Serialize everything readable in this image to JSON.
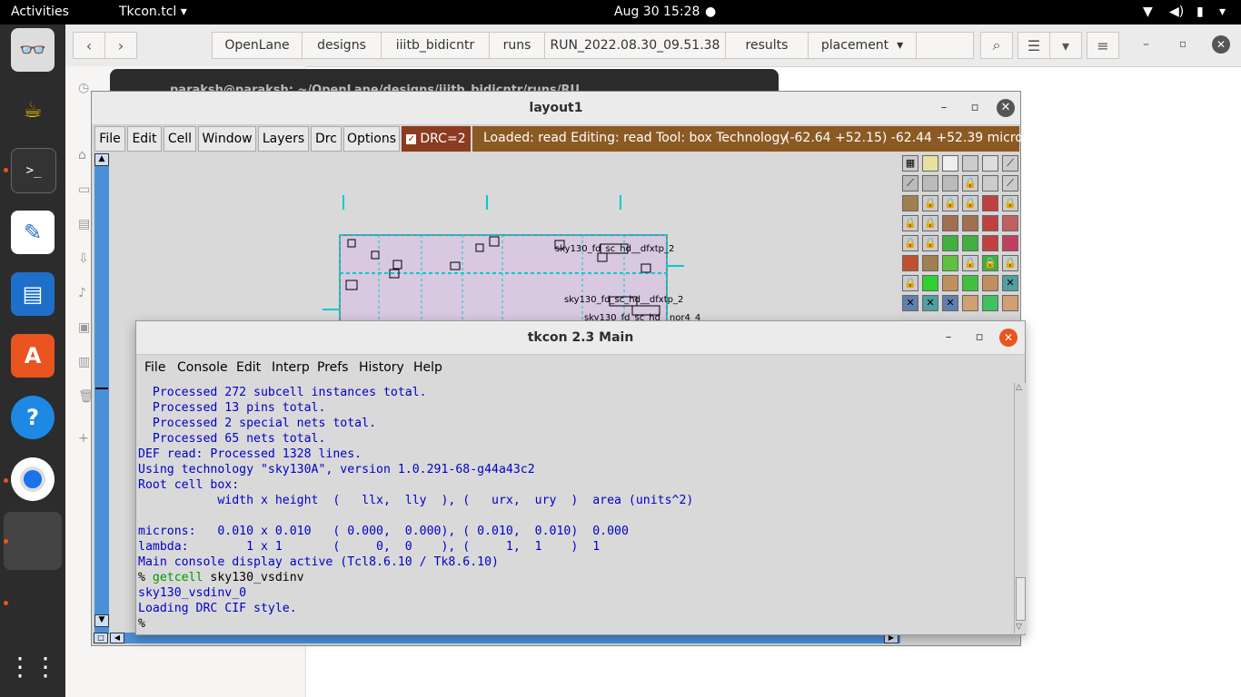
{
  "topbar": {
    "activities": "Activities",
    "app_name": "Tkcon.tcl",
    "datetime": "Aug 30  15:28"
  },
  "nautilus": {
    "path": [
      "OpenLane",
      "designs",
      "iiitb_bidicntr",
      "runs",
      "RUN_2022.08.30_09.51.38",
      "results",
      "placement"
    ]
  },
  "bg_terminal": {
    "title": "paraksh@paraksh: ~/OpenLane/designs/iiitb_bidicntr/runs/RU..."
  },
  "layout1": {
    "title": "layout1",
    "menu": [
      "File",
      "Edit",
      "Cell",
      "Window",
      "Layers",
      "Drc",
      "Options"
    ],
    "drc_label": "DRC=2",
    "status_text": "Loaded: read Editing: read Tool: box  Technology",
    "coords": "(-62.64 +52.15) -62.44 +52.39 microns",
    "cell_labels": [
      "sky130_fd_sc_hd__dfxtp_2",
      "sky130_fd_sc_hd__dfxtp_2",
      "sky130_fd_sc_hd__nor4_4"
    ]
  },
  "tkcon": {
    "title": "tkcon 2.3 Main",
    "menu": [
      "File",
      "Console",
      "Edit",
      "Interp",
      "Prefs",
      "History",
      "Help"
    ],
    "lines": [
      "  Processed 272 subcell instances total.",
      "  Processed 13 pins total.",
      "  Processed 2 special nets total.",
      "  Processed 65 nets total.",
      "DEF read: Processed 1328 lines.",
      "Using technology \"sky130A\", version 1.0.291-68-g44a43c2",
      "Root cell box:",
      "           width x height  (   llx,  lly  ), (   urx,  ury  )  area (units^2)",
      "",
      "microns:   0.010 x 0.010   ( 0.000,  0.000), ( 0.010,  0.010)  0.000",
      "lambda:        1 x 1       (     0,  0    ), (     1,  1    )  1",
      "Main console display active (Tcl8.6.10 / Tk8.6.10)"
    ],
    "prompt": "% ",
    "command_keyword": "getcell",
    "command_arg": " sky130_vsdinv",
    "output1": "sky130_vsdinv_0",
    "output2": "Loading DRC CIF style.",
    "final_prompt": "%"
  }
}
